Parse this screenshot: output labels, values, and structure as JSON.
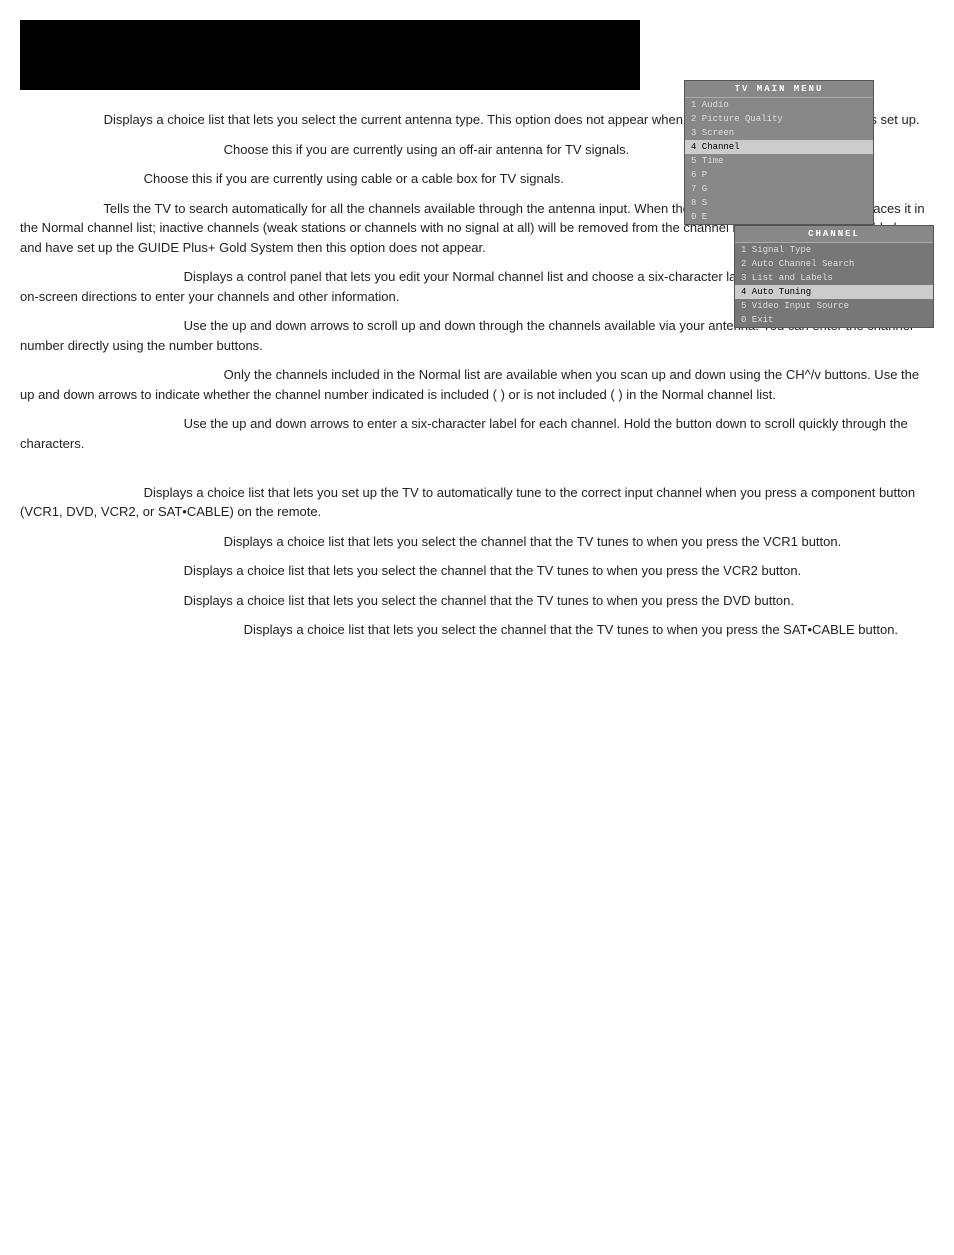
{
  "header": {
    "bar_label": ""
  },
  "tv_main_menu": {
    "title": "TV MAIN MENU",
    "items": [
      {
        "number": "1",
        "label": "Audio",
        "highlighted": false
      },
      {
        "number": "2",
        "label": "Picture Quality",
        "highlighted": false
      },
      {
        "number": "3",
        "label": "Screen",
        "highlighted": false
      },
      {
        "number": "4",
        "label": "Channel",
        "highlighted": true
      },
      {
        "number": "5",
        "label": "Time",
        "highlighted": false
      },
      {
        "number": "6",
        "label": "P...",
        "highlighted": false
      },
      {
        "number": "7",
        "label": "G...",
        "highlighted": false
      },
      {
        "number": "8",
        "label": "S...",
        "highlighted": false
      },
      {
        "number": "0",
        "label": "E...",
        "highlighted": false
      }
    ]
  },
  "channel_menu": {
    "title": "CHANNEL",
    "items": [
      {
        "number": "1",
        "label": "Signal Type",
        "highlighted": false
      },
      {
        "number": "2",
        "label": "Auto Channel Search",
        "highlighted": false
      },
      {
        "number": "3",
        "label": "List and Labels",
        "highlighted": false
      },
      {
        "number": "4",
        "label": "Auto Tuning",
        "highlighted": true
      },
      {
        "number": "5",
        "label": "Video Input Source",
        "highlighted": false
      },
      {
        "number": "0",
        "label": "Exit",
        "highlighted": false
      }
    ]
  },
  "paragraphs": [
    {
      "term": "",
      "indent": "small",
      "text": "Displays a choice list that lets you select the current antenna type. This option does not appear when the GUIDE Plus+ Gold System is set up."
    },
    {
      "term": "",
      "indent": "large",
      "text": "Choose this if you are currently using an off-air antenna for TV signals."
    },
    {
      "term": "",
      "indent": "medium",
      "text": "Choose this if you are currently using cable or a cable box for TV signals."
    },
    {
      "term": "",
      "indent": "small",
      "text": "Tells the TV to search automatically for all the channels available through the antenna input. When the TV finds an active channel, it places it in the Normal channel list; inactive channels (weak stations or channels with no signal at all) will be removed from the channel list. If you are using a cable box and have set up the GUIDE Plus+ Gold System then this option does not appear."
    },
    {
      "term": "",
      "indent": "medium",
      "text": "Displays a control panel that lets you edit your Normal channel list and choose a six-character label for each channel. Follow the on-screen directions to enter your channels and other information."
    },
    {
      "term": "",
      "indent": "large",
      "text": "Use the up and down arrows to scroll up and down through the channels available via your antenna. You can enter the channel number directly using the number buttons."
    },
    {
      "term": "",
      "indent": "xlarge",
      "text": "Only the channels included in the Normal list are available when you scan up and down using the CH^/v buttons. Use the up and down arrows to indicate whether the channel number indicated is included (    ) or is not included (    ) in the Normal channel list."
    },
    {
      "term": "",
      "indent": "large",
      "text": "Use the up and down arrows to enter a six-character label for each channel. Hold the button down to scroll quickly through the characters."
    },
    {
      "term": "",
      "indent": "small",
      "text": "Displays a choice list that lets you set up the TV to automatically tune to the correct input channel when you press a component button (VCR1, DVD, VCR2, or SAT•CABLE) on the remote."
    },
    {
      "term": "",
      "indent": "medium",
      "text": "Displays a choice list that lets you select the channel that the TV tunes to when you press the VCR1 button."
    },
    {
      "term": "",
      "indent": "medium",
      "text": "Displays a choice list that lets you select the channel that the TV tunes to when you press the VCR2 button."
    },
    {
      "term": "",
      "indent": "medium",
      "text": "Displays a choice list that lets you select the channel that the TV tunes to when you press the DVD button."
    },
    {
      "term": "",
      "indent": "large",
      "text": "Displays a choice list that lets you select the channel that the TV tunes to when you press the SAT•CABLE button."
    }
  ]
}
